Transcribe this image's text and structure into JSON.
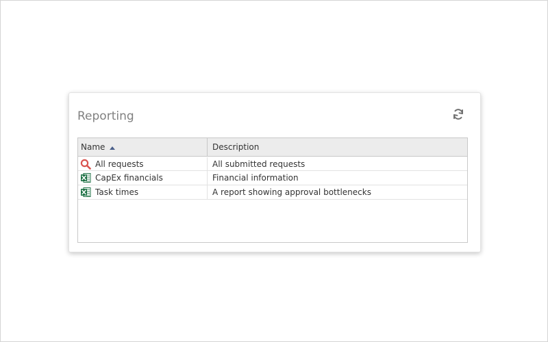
{
  "panel": {
    "title": "Reporting",
    "refresh_icon": "refresh-icon"
  },
  "grid": {
    "columns": [
      {
        "label": "Name",
        "sort": "ascending"
      },
      {
        "label": "Description"
      }
    ],
    "rows": [
      {
        "name": "All requests",
        "description": "All submitted requests",
        "icon": "search-icon"
      },
      {
        "name": "CapEx financials",
        "description": "Financial information",
        "icon": "excel-icon"
      },
      {
        "name": "Task times",
        "description": "A report showing approval bottlenecks",
        "icon": "excel-icon"
      }
    ]
  },
  "colors": {
    "search_icon": "#d9534f",
    "excel_green": "#1e7145",
    "header_bg": "#ececec",
    "sort_arrow": "#4a5f8a"
  }
}
